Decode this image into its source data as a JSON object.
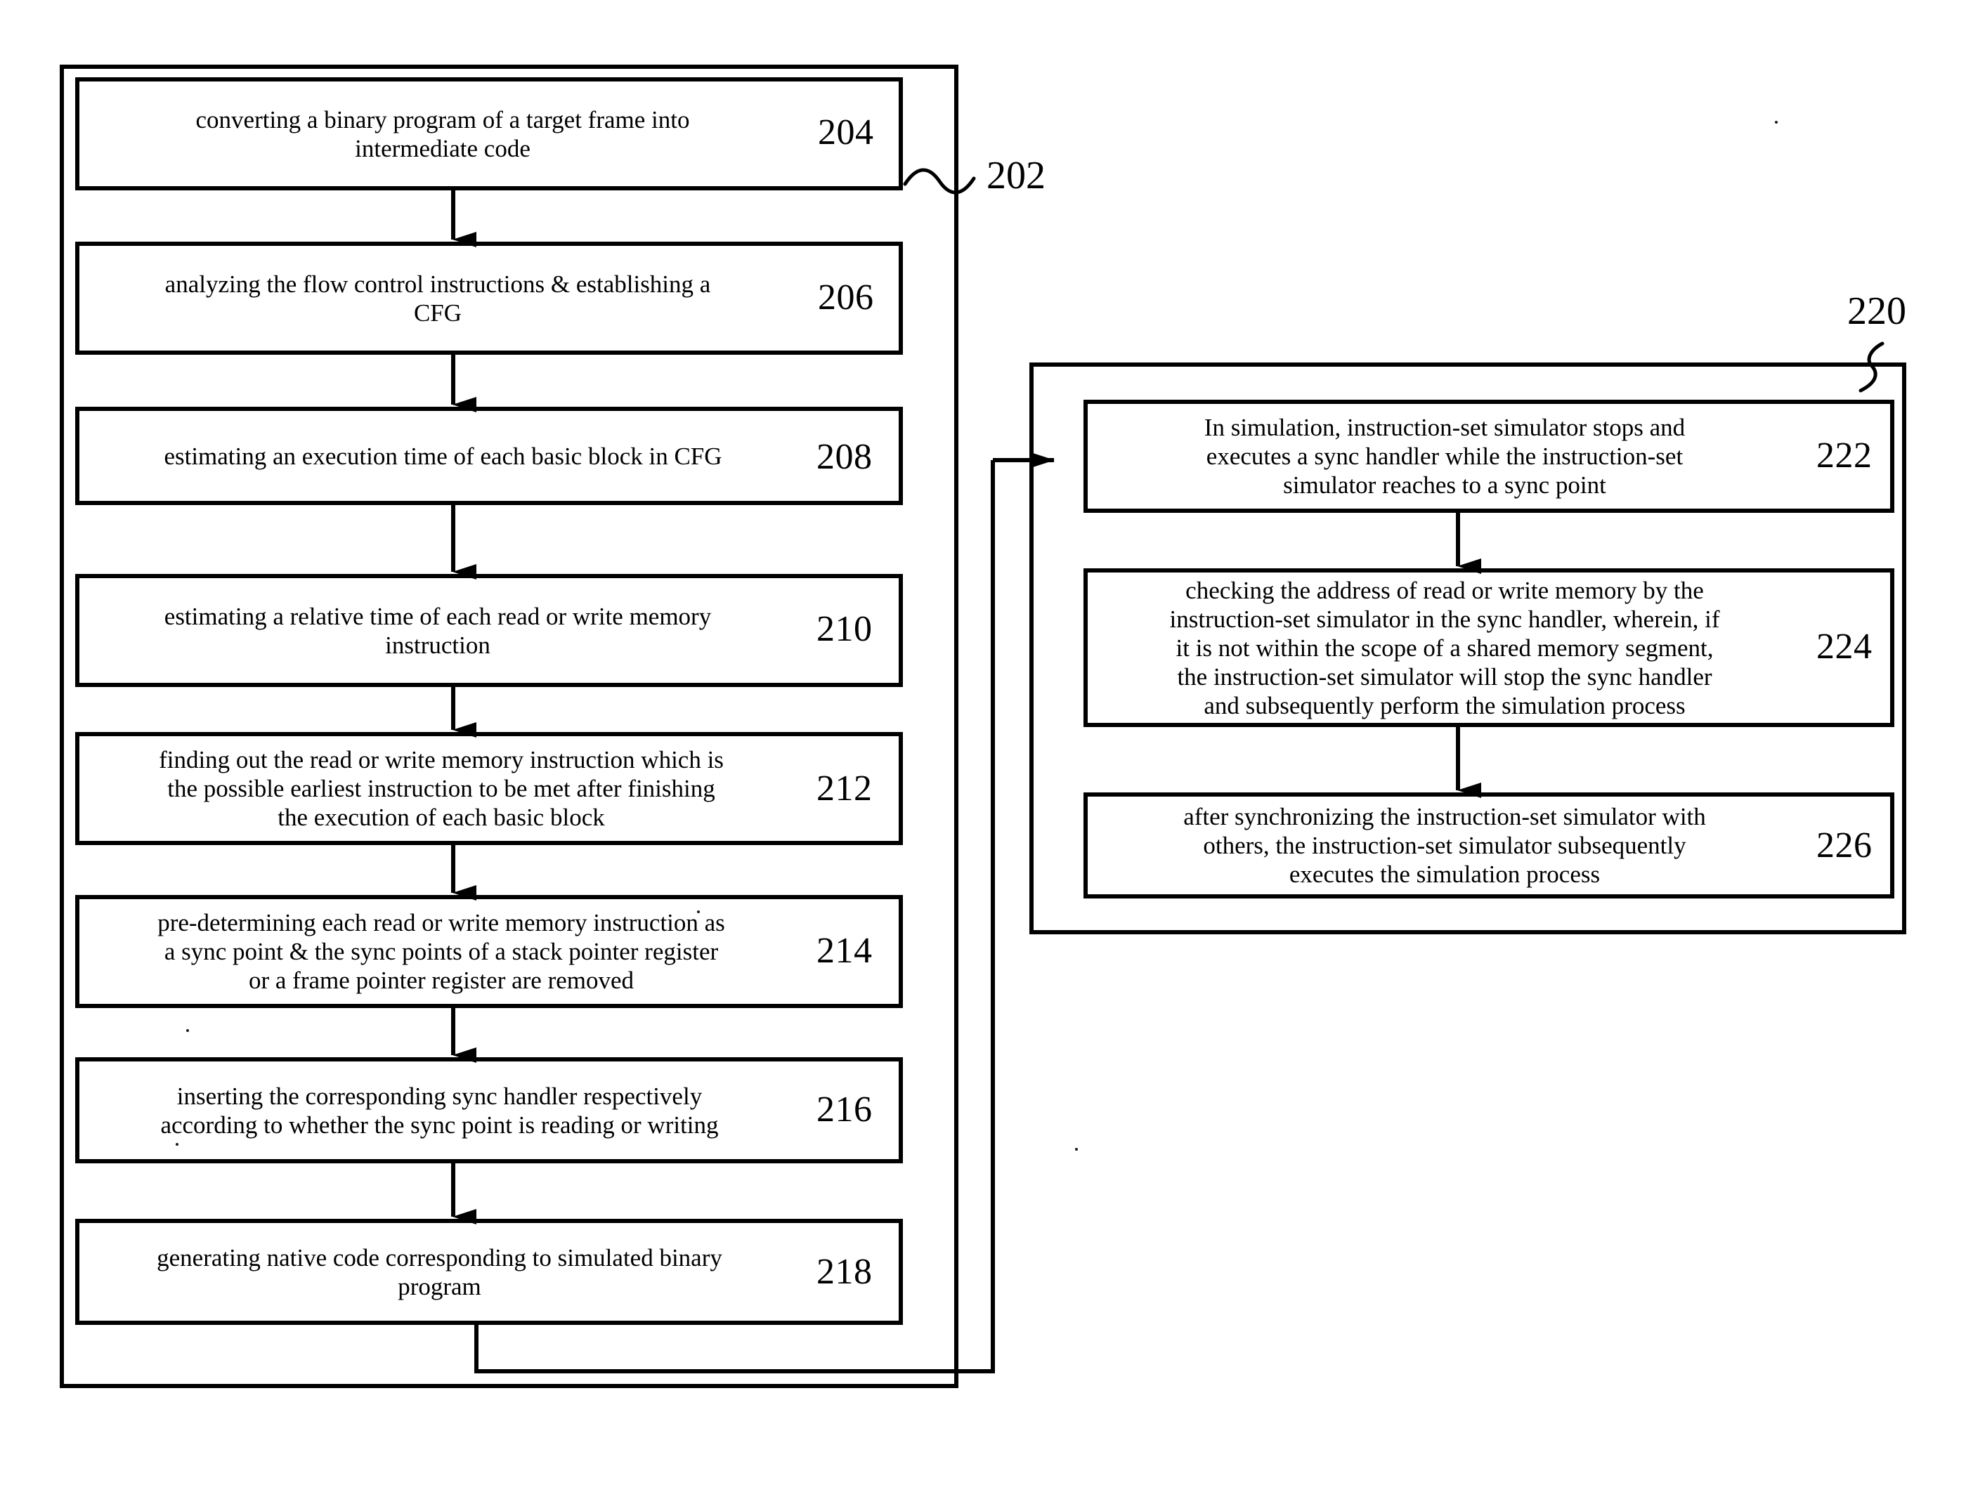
{
  "figure": {
    "type": "patent-flowchart",
    "background_color": "#ffffff",
    "line_color": "#000000"
  },
  "containers": [
    {
      "id": "left-container",
      "ref": "202",
      "lead_label": "202"
    },
    {
      "id": "right-container",
      "ref": "220",
      "lead_label": "220"
    }
  ],
  "left_flow": {
    "steps": [
      {
        "ref": "204",
        "text": "converting a binary program of a target frame into\nintermediate code"
      },
      {
        "ref": "206",
        "text": "analyzing the flow control instructions & establishing a\nCFG"
      },
      {
        "ref": "208",
        "text": "estimating an execution time of each basic block in CFG"
      },
      {
        "ref": "210",
        "text": "estimating a relative time of each read or write memory\ninstruction"
      },
      {
        "ref": "212",
        "text": "finding out the read or write memory instruction which is\nthe possible earliest instruction to be met after finishing\nthe execution of each basic block"
      },
      {
        "ref": "214",
        "text": "pre-determining each read or write memory instruction as\na sync point & the sync points of a stack pointer register\nor a frame pointer register are removed"
      },
      {
        "ref": "216",
        "text": "inserting the corresponding sync handler respectively\naccording to whether the sync point is reading or writing"
      },
      {
        "ref": "218",
        "text": "generating native code corresponding to simulated binary\nprogram"
      }
    ]
  },
  "right_flow": {
    "steps": [
      {
        "ref": "222",
        "text": "In simulation,  instruction-set simulator stops and\nexecutes a sync handler while the instruction-set\nsimulator reaches to a sync point"
      },
      {
        "ref": "224",
        "text": "checking the address of read or write memory by the\ninstruction-set simulator in the sync handler, wherein, if\nit is not within the scope of a shared memory segment,\nthe instruction-set simulator will stop the sync handler\nand subsequently perform the simulation process"
      },
      {
        "ref": "226",
        "text": "after synchronizing the instruction-set simulator with\nothers, the instruction-set simulator subsequently\nexecutes the simulation process"
      }
    ]
  }
}
